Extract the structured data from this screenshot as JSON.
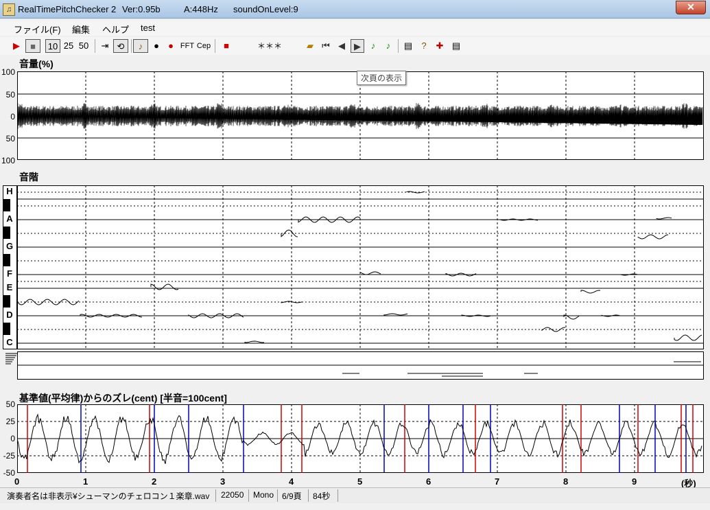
{
  "window": {
    "title_app": "RealTimePitchChecker 2",
    "title_ver": "Ver:0.95b",
    "title_a": "A:448Hz",
    "title_level": "soundOnLevel:9",
    "close_label": "✕"
  },
  "menu": {
    "items": [
      "ファイル(F)",
      "編集",
      "ヘルプ",
      "test"
    ]
  },
  "toolbar": {
    "play": "▶",
    "stop": "■",
    "b10": "10",
    "b25": "25",
    "b50": "50",
    "fft": "FFT",
    "cep": "Cep",
    "display": "＊＊＊"
  },
  "tooltip": "次頁の表示",
  "volume_panel": {
    "title": "音量(%)",
    "ticks": [
      "100",
      "50",
      "0",
      "50",
      "100"
    ]
  },
  "scale_panel": {
    "title": "音階",
    "notes": [
      "H",
      "A",
      "G",
      "F",
      "E",
      "D",
      "C"
    ]
  },
  "cent_panel": {
    "title": "基準値(平均律)からのズレ(cent) [半音=100cent]",
    "ticks": [
      "50",
      "25",
      "0",
      "-25",
      "-50"
    ]
  },
  "x_axis": {
    "ticks": [
      "0",
      "1",
      "2",
      "3",
      "4",
      "5",
      "6",
      "7",
      "8",
      "9"
    ],
    "unit": "(秒)"
  },
  "status": {
    "file": "演奏者名は非表示¥シューマンのチェロコン１楽章.wav",
    "rate": "22050",
    "channels": "Mono",
    "page": "6/9頁",
    "duration": "84秒"
  },
  "colors": {
    "red_marker": "#d00000",
    "blue_marker": "#0000c0",
    "titlebar": "#b9d1ea"
  }
}
